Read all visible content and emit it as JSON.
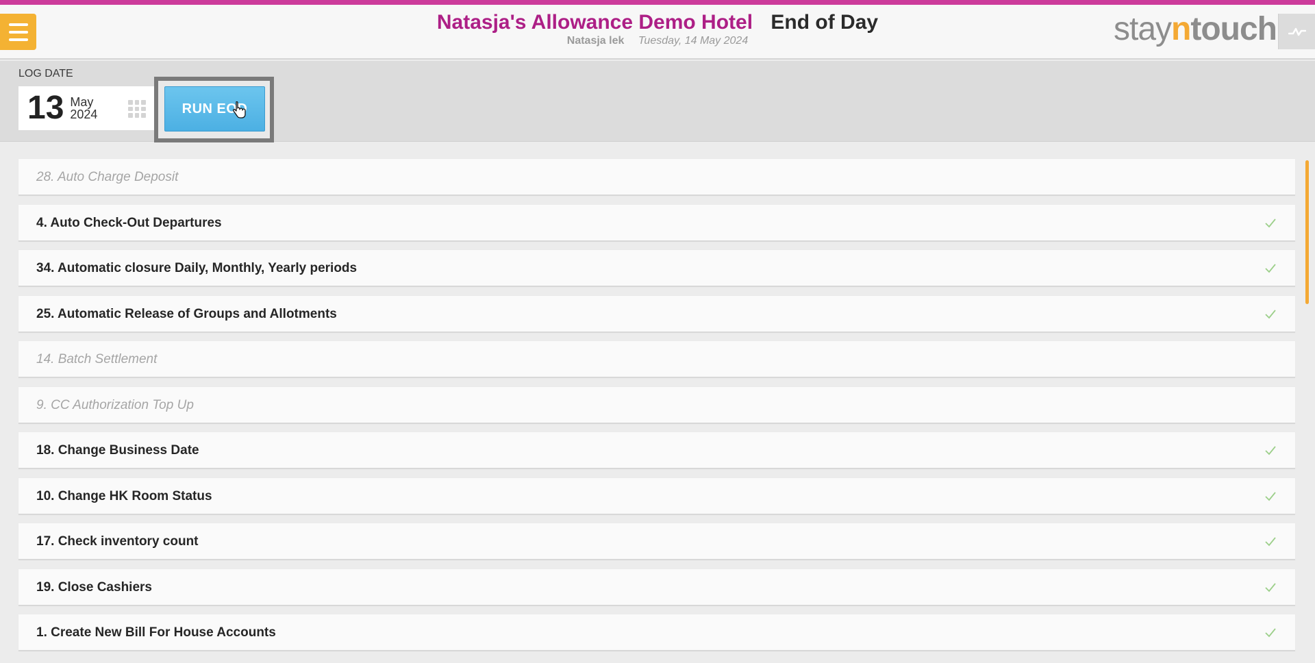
{
  "header": {
    "hotel_name": "Natasja's Allowance Demo Hotel",
    "page_title": "End of Day",
    "user": "Natasja lek",
    "date": "Tuesday, 14 May 2024",
    "logo": {
      "part1": "stay",
      "part2": "n",
      "part3": "touch"
    },
    "accent_color": "#cc3b9b",
    "brand_color": "#ad1f86"
  },
  "toolbar": {
    "log_date_label": "LOG DATE",
    "date_day": "13",
    "date_month": "May",
    "date_year": "2024",
    "run_button_label": "RUN EOD"
  },
  "process_list": [
    {
      "label": "28. Auto Charge Deposit",
      "enabled": false,
      "checked": false
    },
    {
      "label": "4. Auto Check-Out Departures",
      "enabled": true,
      "checked": true
    },
    {
      "label": "34. Automatic closure Daily, Monthly, Yearly periods",
      "enabled": true,
      "checked": true
    },
    {
      "label": "25. Automatic Release of Groups and Allotments",
      "enabled": true,
      "checked": true
    },
    {
      "label": "14. Batch Settlement",
      "enabled": false,
      "checked": false
    },
    {
      "label": "9. CC Authorization Top Up",
      "enabled": false,
      "checked": false
    },
    {
      "label": "18. Change Business Date",
      "enabled": true,
      "checked": true
    },
    {
      "label": "10. Change HK Room Status",
      "enabled": true,
      "checked": true
    },
    {
      "label": "17. Check inventory count",
      "enabled": true,
      "checked": true
    },
    {
      "label": "19. Close Cashiers",
      "enabled": true,
      "checked": true
    },
    {
      "label": "1. Create New Bill For House Accounts",
      "enabled": true,
      "checked": true
    }
  ],
  "icons": {
    "menu": "hamburger-menu-icon",
    "pulse": "activity-icon",
    "calendar": "calendar-grid-icon",
    "check": "checkmark-icon",
    "cursor": "hand-pointer-icon"
  }
}
